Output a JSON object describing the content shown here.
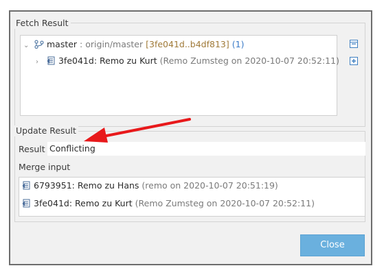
{
  "fetch_result": {
    "title": "Fetch Result",
    "branch": {
      "name": "master",
      "separator": " : ",
      "remote": "origin/master",
      "range": "[3fe041d..b4df813]",
      "count": "(1)"
    },
    "commit": {
      "summary": "3fe041d: Remo zu Kurt",
      "meta": "(Remo Zumsteg on 2020-10-07 20:52:11)"
    }
  },
  "update_result": {
    "title": "Update Result",
    "result_label": "Result",
    "result_value": "Conflicting",
    "merge_input_label": "Merge input",
    "merge_inputs": [
      {
        "summary": "6793951: Remo zu Hans",
        "meta": "(remo on 2020-10-07 20:51:19)"
      },
      {
        "summary": "3fe041d: Remo zu Kurt",
        "meta": "(Remo Zumsteg on 2020-10-07 20:52:11)"
      }
    ]
  },
  "buttons": {
    "close": "Close"
  },
  "colors": {
    "accent": "#6ab0de",
    "arrow": "#e8191b",
    "range": "#a07a38",
    "count": "#3b7bc8"
  }
}
